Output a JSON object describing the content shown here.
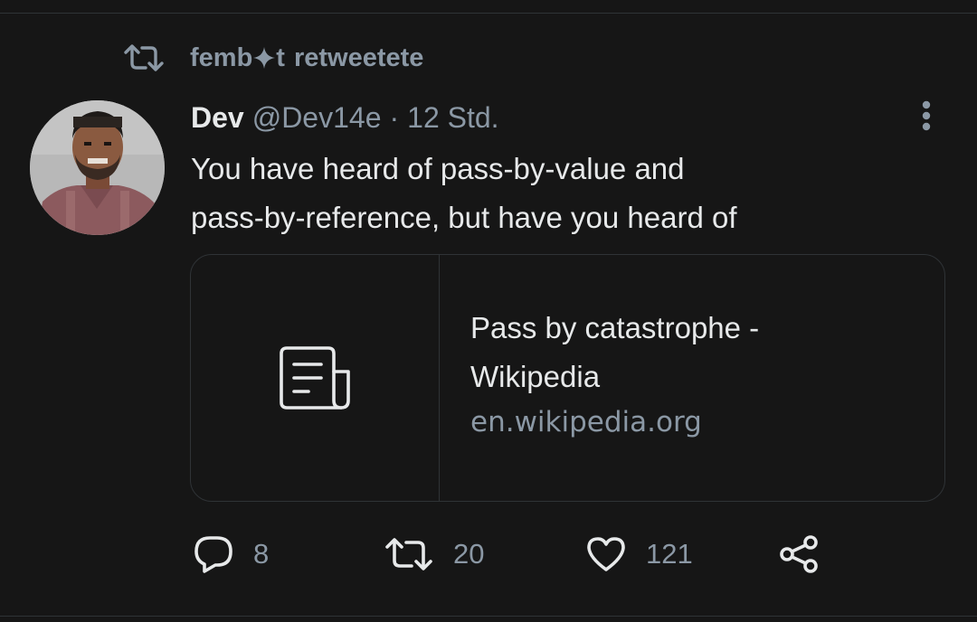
{
  "social_context": {
    "retweeter_prefix": "femb",
    "retweeter_suffix": "t",
    "action_text": "retweetete",
    "icon": "retweet-icon"
  },
  "tweet": {
    "author": {
      "name": "Dev",
      "handle": "@Dev14e"
    },
    "separator": "·",
    "timestamp": "12 Std.",
    "text_lines": [
      "You have heard of pass-by-value and",
      "pass-by-reference, but have you heard of"
    ],
    "link_card": {
      "title_lines": [
        "Pass by catastrophe -",
        "Wikipedia"
      ],
      "domain": "en.wikipedia.org",
      "icon": "document-icon"
    },
    "actions": {
      "reply_count": "8",
      "retweet_count": "20",
      "like_count": "121"
    }
  },
  "colors": {
    "background": "#161616",
    "primary_text": "#e7e9ea",
    "secondary_text": "#8b98a5",
    "border": "#2f3336"
  }
}
